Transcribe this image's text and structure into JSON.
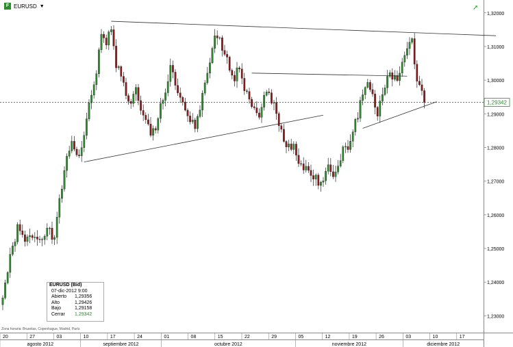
{
  "header": {
    "symbol": "EURUSD",
    "icon_label": "F"
  },
  "icons": {
    "symbol_icon": "chart-app-icon",
    "trend_icon": "trend-arrow-icon"
  },
  "timezone_note": "Zona horaria: Bruselas, Copenhague, Madrid, París",
  "info_box": {
    "title": "EURUSD (Bid)",
    "datetime": "07-dic-2012 9:00",
    "rows": [
      {
        "label": "Abierto",
        "value": "1,29356"
      },
      {
        "label": "Alto",
        "value": "1,29426"
      },
      {
        "label": "Bajo",
        "value": "1,29158"
      },
      {
        "label": "Cerrar",
        "value": "1,29342"
      }
    ]
  },
  "colors": {
    "up": "#2e8b2e",
    "down": "#8b1a1a",
    "current_price_line": "#cc0000",
    "current_price_label": "#2e8b2e"
  },
  "chart_data": {
    "type": "candlestick",
    "ylim": [
      1.225,
      1.323
    ],
    "yticks": [
      "1,23000",
      "1,24000",
      "1,25000",
      "1,26000",
      "1,27000",
      "1,28000",
      "1,29000",
      "1,30000",
      "1,31000",
      "1,32000"
    ],
    "ytick_values": [
      1.23,
      1.24,
      1.25,
      1.26,
      1.27,
      1.28,
      1.29,
      1.3,
      1.31,
      1.32
    ],
    "current_price": 1.29342,
    "current_price_label": "1,29342",
    "x_day_ticks": [
      "20",
      "27",
      "03",
      "10",
      "17",
      "24",
      "01",
      "08",
      "15",
      "22",
      "29",
      "05",
      "12",
      "19",
      "26",
      "03",
      "10",
      "17"
    ],
    "x_months": [
      "agosto 2012",
      "septiembre 2012",
      "octubre 2012",
      "noviembre 2012",
      "diciembre 2012"
    ],
    "path": [
      [
        0,
        1.236
      ],
      [
        3,
        1.247
      ],
      [
        6,
        1.256
      ],
      [
        9,
        1.252
      ],
      [
        12,
        1.254
      ],
      [
        15,
        1.253
      ],
      [
        18,
        1.256
      ],
      [
        21,
        1.252
      ],
      [
        23,
        1.265
      ],
      [
        26,
        1.276
      ],
      [
        28,
        1.282
      ],
      [
        30,
        1.278
      ],
      [
        32,
        1.279
      ],
      [
        34,
        1.289
      ],
      [
        36,
        1.295
      ],
      [
        38,
        1.303
      ],
      [
        40,
        1.313
      ],
      [
        42,
        1.311
      ],
      [
        44,
        1.316
      ],
      [
        46,
        1.305
      ],
      [
        48,
        1.301
      ],
      [
        50,
        1.296
      ],
      [
        52,
        1.293
      ],
      [
        54,
        1.297
      ],
      [
        56,
        1.29
      ],
      [
        58,
        1.288
      ],
      [
        60,
        1.284
      ],
      [
        62,
        1.286
      ],
      [
        64,
        1.293
      ],
      [
        66,
        1.296
      ],
      [
        68,
        1.304
      ],
      [
        70,
        1.298
      ],
      [
        72,
        1.294
      ],
      [
        74,
        1.291
      ],
      [
        76,
        1.288
      ],
      [
        78,
        1.286
      ],
      [
        80,
        1.292
      ],
      [
        82,
        1.298
      ],
      [
        84,
        1.305
      ],
      [
        86,
        1.312
      ],
      [
        88,
        1.312
      ],
      [
        90,
        1.307
      ],
      [
        92,
        1.304
      ],
      [
        94,
        1.301
      ],
      [
        96,
        1.304
      ],
      [
        98,
        1.298
      ],
      [
        100,
        1.295
      ],
      [
        102,
        1.292
      ],
      [
        104,
        1.29
      ],
      [
        106,
        1.295
      ],
      [
        108,
        1.296
      ],
      [
        110,
        1.293
      ],
      [
        112,
        1.286
      ],
      [
        114,
        1.283
      ],
      [
        116,
        1.28
      ],
      [
        118,
        1.281
      ],
      [
        120,
        1.276
      ],
      [
        122,
        1.274
      ],
      [
        124,
        1.273
      ],
      [
        126,
        1.271
      ],
      [
        128,
        1.27
      ],
      [
        130,
        1.271
      ],
      [
        132,
        1.274
      ],
      [
        134,
        1.271
      ],
      [
        136,
        1.274
      ],
      [
        138,
        1.279
      ],
      [
        140,
        1.28
      ],
      [
        142,
        1.285
      ],
      [
        144,
        1.29
      ],
      [
        146,
        1.296
      ],
      [
        148,
        1.299
      ],
      [
        150,
        1.296
      ],
      [
        152,
        1.29
      ],
      [
        154,
        1.295
      ],
      [
        156,
        1.301
      ],
      [
        158,
        1.301
      ],
      [
        160,
        1.301
      ],
      [
        162,
        1.305
      ],
      [
        164,
        1.309
      ],
      [
        166,
        1.311
      ],
      [
        168,
        1.301
      ],
      [
        170,
        1.296
      ],
      [
        171,
        1.2934
      ]
    ],
    "trendlines": [
      {
        "name": "upper",
        "p1": [
          44,
          1.3175
        ],
        "p2": [
          200,
          1.3132
        ]
      },
      {
        "name": "lower-left",
        "p1": [
          33,
          1.2757
        ],
        "p2": [
          130,
          1.2896
        ]
      },
      {
        "name": "neckline",
        "p1": [
          101,
          1.3021
        ],
        "p2": [
          164,
          1.3012
        ]
      },
      {
        "name": "lower-right",
        "p1": [
          146,
          1.2857
        ],
        "p2": [
          176,
          1.2936
        ]
      }
    ]
  }
}
